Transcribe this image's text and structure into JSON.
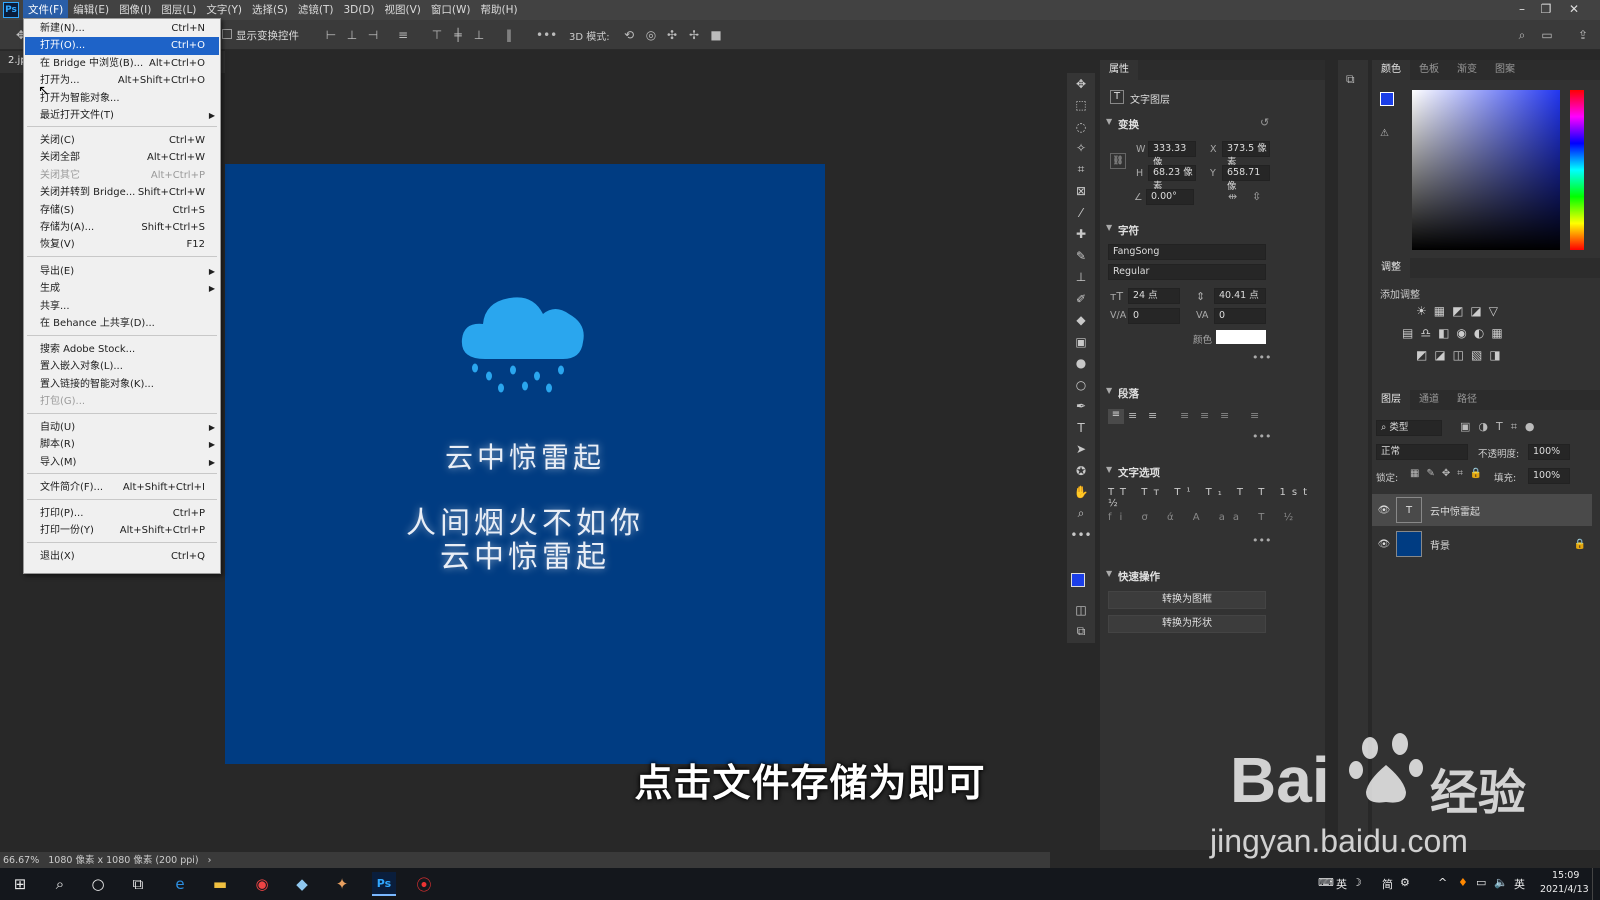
{
  "app": {
    "name": "Ps"
  },
  "menubar": {
    "items": [
      "文件(F)",
      "编辑(E)",
      "图像(I)",
      "图层(L)",
      "文字(Y)",
      "选择(S)",
      "滤镜(T)",
      "3D(D)",
      "视图(V)",
      "窗口(W)",
      "帮助(H)"
    ]
  },
  "options_bar": {
    "show_transform_label": "显示变换控件",
    "mode3d_label": "3D 模式:"
  },
  "doc_tab": {
    "label": "2.jp"
  },
  "file_menu": {
    "items": [
      {
        "label": "新建(N)...",
        "shortcut": "Ctrl+N"
      },
      {
        "label": "打开(O)...",
        "shortcut": "Ctrl+O"
      },
      {
        "label": "在 Bridge 中浏览(B)...",
        "shortcut": "Alt+Ctrl+O"
      },
      {
        "label": "打开为...",
        "shortcut": "Alt+Shift+Ctrl+O"
      },
      {
        "label": "打开为智能对象...",
        "shortcut": ""
      },
      {
        "label": "最近打开文件(T)",
        "shortcut": ""
      },
      {
        "label": "关闭(C)",
        "shortcut": "Ctrl+W"
      },
      {
        "label": "关闭全部",
        "shortcut": "Alt+Ctrl+W"
      },
      {
        "label": "关闭其它",
        "shortcut": "Alt+Ctrl+P"
      },
      {
        "label": "关闭并转到 Bridge...",
        "shortcut": "Shift+Ctrl+W"
      },
      {
        "label": "存储(S)",
        "shortcut": "Ctrl+S"
      },
      {
        "label": "存储为(A)...",
        "shortcut": "Shift+Ctrl+S"
      },
      {
        "label": "恢复(V)",
        "shortcut": "F12"
      },
      {
        "label": "导出(E)",
        "shortcut": ""
      },
      {
        "label": "生成",
        "shortcut": ""
      },
      {
        "label": "共享...",
        "shortcut": ""
      },
      {
        "label": "在 Behance 上共享(D)...",
        "shortcut": ""
      },
      {
        "label": "搜索 Adobe Stock...",
        "shortcut": ""
      },
      {
        "label": "置入嵌入对象(L)...",
        "shortcut": ""
      },
      {
        "label": "置入链接的智能对象(K)...",
        "shortcut": ""
      },
      {
        "label": "打包(G)...",
        "shortcut": ""
      },
      {
        "label": "自动(U)",
        "shortcut": ""
      },
      {
        "label": "脚本(R)",
        "shortcut": ""
      },
      {
        "label": "导入(M)",
        "shortcut": ""
      },
      {
        "label": "文件简介(F)...",
        "shortcut": "Alt+Shift+Ctrl+I"
      },
      {
        "label": "打印(P)...",
        "shortcut": "Ctrl+P"
      },
      {
        "label": "打印一份(Y)",
        "shortcut": "Alt+Shift+Ctrl+P"
      },
      {
        "label": "退出(X)",
        "shortcut": "Ctrl+Q"
      }
    ]
  },
  "artboard": {
    "bg_color": "#003c82",
    "line1": "云中惊雷起",
    "line2": "人间烟火不如你",
    "line3": "云中惊雷起"
  },
  "status": {
    "zoom": "66.67%",
    "doc_info": "1080 像素 x 1080 像素 (200 ppi)"
  },
  "properties": {
    "tabs": [
      "属性"
    ],
    "layer_kind": "文字图层",
    "transform": {
      "title": "变换",
      "w_label": "W",
      "w": "333.33 像",
      "x_label": "X",
      "x": "373.5 像素",
      "h_label": "H",
      "h": "68.23 像素",
      "y_label": "Y",
      "y": "658.71 像",
      "angle": "0.00°"
    },
    "character": {
      "title": "字符",
      "font": "FangSong",
      "style": "Regular",
      "size": "24 点",
      "leading": "40.41 点",
      "kerning": "0",
      "tracking": "0",
      "color_label": "颜色"
    },
    "paragraph": {
      "title": "段落"
    },
    "text_options": {
      "title": "文字选项"
    },
    "quick_actions": {
      "title": "快速操作",
      "btn1": "转换为图框",
      "btn2": "转换为形状"
    }
  },
  "color_panel": {
    "tabs": [
      "颜色",
      "色板",
      "渐变",
      "图案"
    ]
  },
  "adjust_panel": {
    "tab": "调整",
    "add_label": "添加调整"
  },
  "layers_panel": {
    "tabs": [
      "图层",
      "通道",
      "路径"
    ],
    "filter": "类型",
    "blend": "正常",
    "opacity_label": "不透明度:",
    "opacity": "100%",
    "lock_label": "锁定:",
    "fill_label": "填充:",
    "fill": "100%",
    "layers": [
      {
        "name": "云中惊雷起",
        "type": "text"
      },
      {
        "name": "背景",
        "type": "image"
      }
    ]
  },
  "subtitle": "点击文件存储为即可",
  "watermark": {
    "brand": "Bai",
    "brand2": "经验",
    "url": "jingyan.baidu.com"
  },
  "taskbar": {
    "tray": [
      "英",
      "简"
    ],
    "ime": "英",
    "time": "15:09",
    "date": "2021/4/13"
  }
}
